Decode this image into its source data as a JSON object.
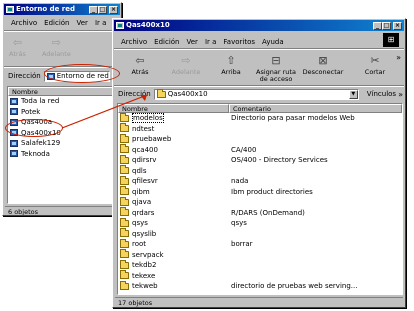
{
  "win1": {
    "title": "Entorno de red",
    "min": "_",
    "max": "□",
    "close": "×",
    "menu": [
      "Archivo",
      "Edición",
      "Ver",
      "Ir a"
    ],
    "toolbar": [
      {
        "label": "Atrás",
        "icon": "arrow-left",
        "glyph": "⇦",
        "disabled": true
      },
      {
        "label": "Adelante",
        "icon": "arrow-right",
        "glyph": "⇨",
        "disabled": true
      }
    ],
    "address_label": "Dirección",
    "address_value": "Entorno de red",
    "col_name": "Nombre",
    "items": [
      "Toda la red",
      "Potek",
      "Qas400a",
      "Qas400x10",
      "Salafek129",
      "Teknoda"
    ],
    "status": "6 objetos"
  },
  "win2": {
    "title": "Qas400x10",
    "min": "_",
    "max": "□",
    "close": "×",
    "menu": [
      "Archivo",
      "Edición",
      "Ver",
      "Ir a",
      "Favoritos",
      "Ayuda"
    ],
    "toolbar": [
      {
        "label": "Atrás",
        "icon": "arrow-left",
        "glyph": "⇦",
        "disabled": false
      },
      {
        "label": "Adelante",
        "icon": "arrow-right",
        "glyph": "⇨",
        "disabled": true
      },
      {
        "label": "Arriba",
        "icon": "up-folder",
        "glyph": "⇧",
        "disabled": false
      },
      {
        "label": "Asignar ruta de acceso",
        "icon": "map-drive",
        "glyph": "⊟",
        "disabled": false
      },
      {
        "label": "Desconectar",
        "icon": "disconnect-drive",
        "glyph": "⊠",
        "disabled": false
      },
      {
        "label": "Cortar",
        "icon": "scissors",
        "glyph": "✂",
        "disabled": false
      }
    ],
    "more_glyph": "»",
    "address_label": "Dirección",
    "address_value": "Qas400x10",
    "links_label": "Vínculos",
    "col_name": "Nombre",
    "col_comment": "Comentario",
    "rows": [
      {
        "name": "modelos",
        "comment": "Directorio para pasar modelos Web"
      },
      {
        "name": "ndtest",
        "comment": ""
      },
      {
        "name": "pruebaweb",
        "comment": ""
      },
      {
        "name": "qca400",
        "comment": "CA/400"
      },
      {
        "name": "qdirsrv",
        "comment": "OS/400 - Directory Services"
      },
      {
        "name": "qdls",
        "comment": ""
      },
      {
        "name": "qfilesvr",
        "comment": "nada"
      },
      {
        "name": "qibm",
        "comment": "Ibm product directories"
      },
      {
        "name": "qjava",
        "comment": ""
      },
      {
        "name": "qrdars",
        "comment": "R/DARS (OnDemand)"
      },
      {
        "name": "qsys",
        "comment": "qsys"
      },
      {
        "name": "qsyslib",
        "comment": ""
      },
      {
        "name": "root",
        "comment": "borrar"
      },
      {
        "name": "servpack",
        "comment": ""
      },
      {
        "name": "tekdb2",
        "comment": ""
      },
      {
        "name": "tekexe",
        "comment": ""
      },
      {
        "name": "tekweb",
        "comment": "directorio de pruebas web serving..."
      }
    ],
    "status": "17 objetos"
  },
  "colors": {
    "title_start": "#000080",
    "title_end": "#1084d0",
    "window_bg": "#c0c0c0",
    "annotation": "#cc2200",
    "folder": "#f4d35e"
  }
}
